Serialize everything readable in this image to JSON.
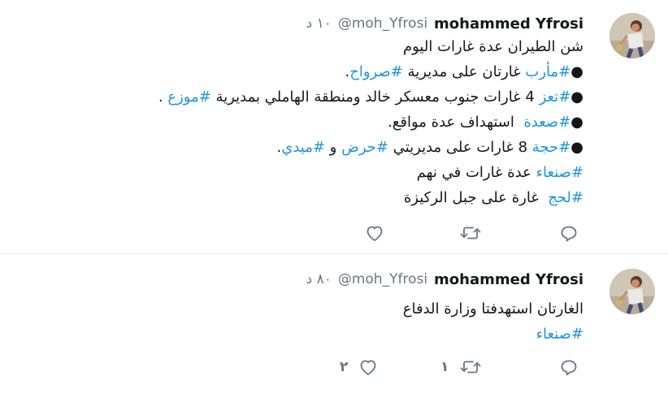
{
  "tweets": [
    {
      "author": {
        "name": "mohammed Yfrosi",
        "handle": "@moh_Yfrosi"
      },
      "time": "١٠ د",
      "lines": [
        [
          {
            "text": "شن الطيران عدة غارات اليوم",
            "link": false
          }
        ],
        [
          {
            "text": "●",
            "link": false
          },
          {
            "text": "#مأرب",
            "link": true
          },
          {
            "text": " غارتان على مديرية ",
            "link": false
          },
          {
            "text": "#صرواح",
            "link": true
          },
          {
            "text": ".",
            "link": false
          }
        ],
        [
          {
            "text": "●",
            "link": false
          },
          {
            "text": "#تعز",
            "link": true
          },
          {
            "text": " 4 غارات جنوب معسكر خالد ومنطقة الهاملي بمديرية ",
            "link": false
          },
          {
            "text": "#موزع",
            "link": true
          },
          {
            "text": " .",
            "link": false
          }
        ],
        [
          {
            "text": "●",
            "link": false
          },
          {
            "text": "#صعدة",
            "link": true
          },
          {
            "text": "  استهداف عدة مواقع.",
            "link": false
          }
        ],
        [
          {
            "text": "●",
            "link": false
          },
          {
            "text": "#حجة",
            "link": true
          },
          {
            "text": " 8 غارات على مديريتي ",
            "link": false
          },
          {
            "text": "#حرض",
            "link": true
          },
          {
            "text": " و ",
            "link": false
          },
          {
            "text": "#ميدي",
            "link": true
          },
          {
            "text": ".",
            "link": false
          }
        ],
        [
          {
            "text": "#صنعاء",
            "link": true
          },
          {
            "text": " عدة غارات في نهم",
            "link": false
          }
        ],
        [
          {
            "text": "#لحج",
            "link": true
          },
          {
            "text": "  غارة على جبل الركيزة",
            "link": false
          }
        ]
      ],
      "actions": {
        "retweet_count": "",
        "like_count": ""
      }
    },
    {
      "author": {
        "name": "mohammed Yfrosi",
        "handle": "@moh_Yfrosi"
      },
      "time": "٨٠ د",
      "lines": [
        [
          {
            "text": "الغارتان استهدفتا وزارة الدفاع",
            "link": false
          }
        ],
        [
          {
            "text": "#صنعاء",
            "link": true
          }
        ]
      ],
      "actions": {
        "retweet_count": "١",
        "like_count": "٢"
      }
    }
  ],
  "icons": {
    "reply": "reply-icon",
    "retweet": "retweet-icon",
    "like": "heart-icon"
  },
  "colors": {
    "link": "#1b95e0",
    "secondary": "#657786",
    "divider": "#e6ecf0"
  }
}
